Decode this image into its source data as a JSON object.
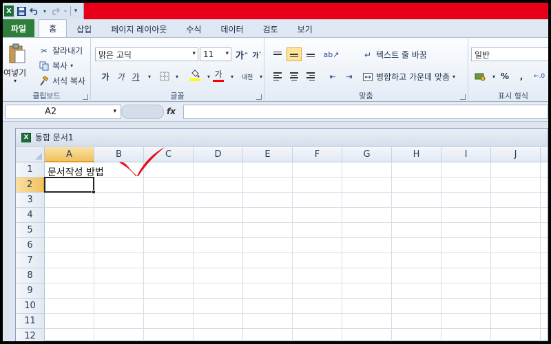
{
  "quick_access": {
    "save_icon": "save-icon",
    "undo_icon": "undo-icon",
    "redo_icon": "redo-icon"
  },
  "tabs": [
    {
      "label": "파일"
    },
    {
      "label": "홈"
    },
    {
      "label": "삽입"
    },
    {
      "label": "페이지 레이아웃"
    },
    {
      "label": "수식"
    },
    {
      "label": "데이터"
    },
    {
      "label": "검토"
    },
    {
      "label": "보기"
    }
  ],
  "clipboard": {
    "paste": "붙여넣기",
    "cut": "잘라내기",
    "copy": "복사",
    "format_painter": "서식 복사",
    "group_label": "클립보드"
  },
  "font": {
    "name": "맑은 고딕",
    "size": "11",
    "grow": "가",
    "shrink": "가",
    "bold": "가",
    "italic": "가",
    "underline": "가",
    "font_color": "가",
    "phonetic": "내천",
    "group_label": "글꼴"
  },
  "alignment": {
    "wrap_text": "텍스트 줄 바꿈",
    "merge_center": "병합하고 가운데 맞춤",
    "group_label": "맞춤"
  },
  "number": {
    "format": "일반",
    "percent": "%",
    "comma": ",",
    "group_label": "표시 형식"
  },
  "formula_bar": {
    "name_box": "A2",
    "fx": "fx",
    "value": ""
  },
  "workbook": {
    "title": "통합 문서1"
  },
  "columns": [
    "A",
    "B",
    "C",
    "D",
    "E",
    "F",
    "G",
    "H",
    "I",
    "J"
  ],
  "rows": [
    "1",
    "2",
    "3",
    "4",
    "5",
    "6",
    "7",
    "8",
    "9",
    "10",
    "11",
    "12"
  ],
  "cells": {
    "A1": "문서작성 방법"
  },
  "colors": {
    "title_bar": "#e8001a",
    "file_tab": "#2e7d3a",
    "selection": "#f1c15f",
    "checkmark": "#e3101b"
  }
}
